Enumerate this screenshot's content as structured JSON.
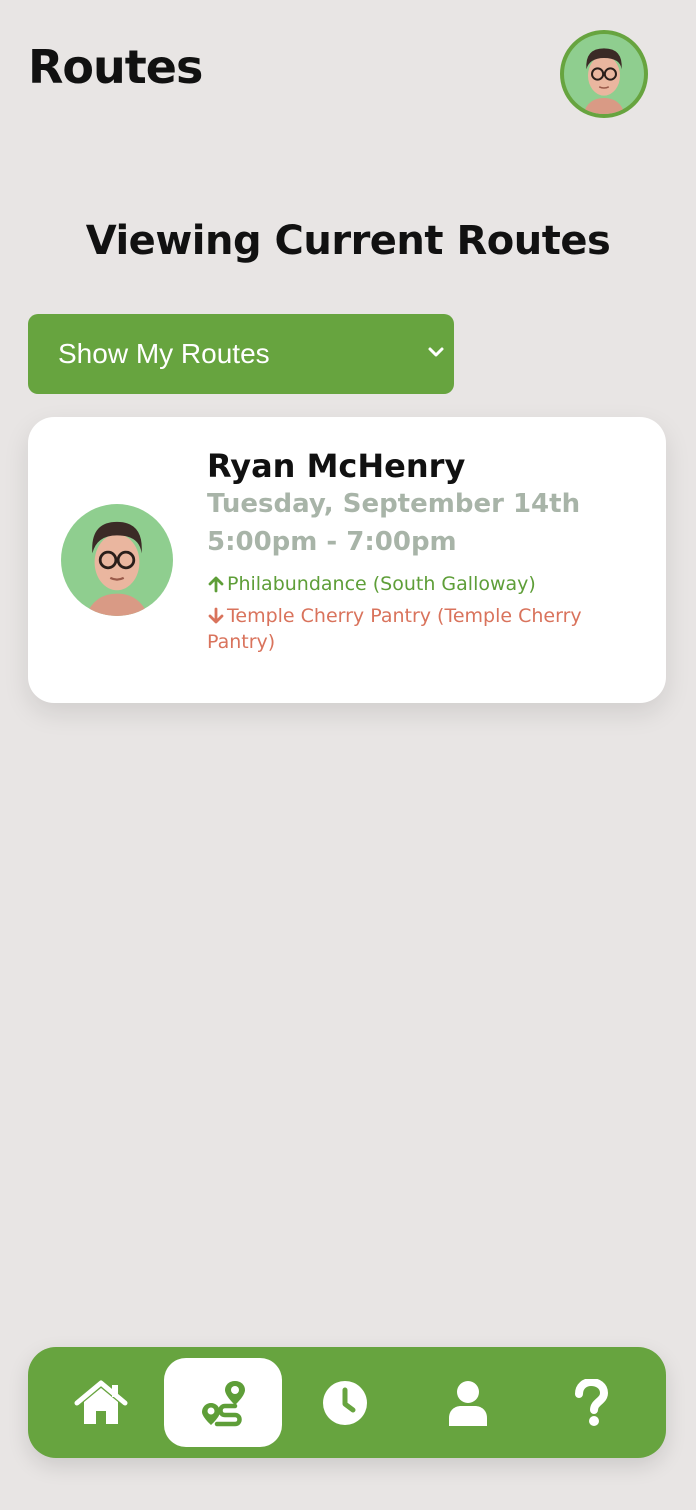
{
  "header": {
    "title": "Routes",
    "avatar_icon": "user-avatar-icon"
  },
  "section": {
    "title": "Viewing Current Routes"
  },
  "filter": {
    "selected": "Show My Routes"
  },
  "route_card": {
    "name": "Ryan McHenry",
    "date": "Tuesday, September 14th",
    "time": "5:00pm - 7:00pm",
    "pickup": "Philabundance (South Galloway)",
    "dropoff": "Temple Cherry Pantry (Temple Cherry Pantry)"
  },
  "nav": {
    "items": [
      {
        "name": "home",
        "icon": "home-icon",
        "active": false
      },
      {
        "name": "routes",
        "icon": "route-icon",
        "active": true
      },
      {
        "name": "history",
        "icon": "clock-icon",
        "active": false
      },
      {
        "name": "profile",
        "icon": "user-icon",
        "active": false
      },
      {
        "name": "help",
        "icon": "question-icon",
        "active": false
      }
    ]
  },
  "colors": {
    "accent": "#67a43f",
    "background": "#e8e5e4",
    "pickup": "#5e9e38",
    "dropoff": "#d9735c",
    "muted": "#a8b4a8"
  }
}
